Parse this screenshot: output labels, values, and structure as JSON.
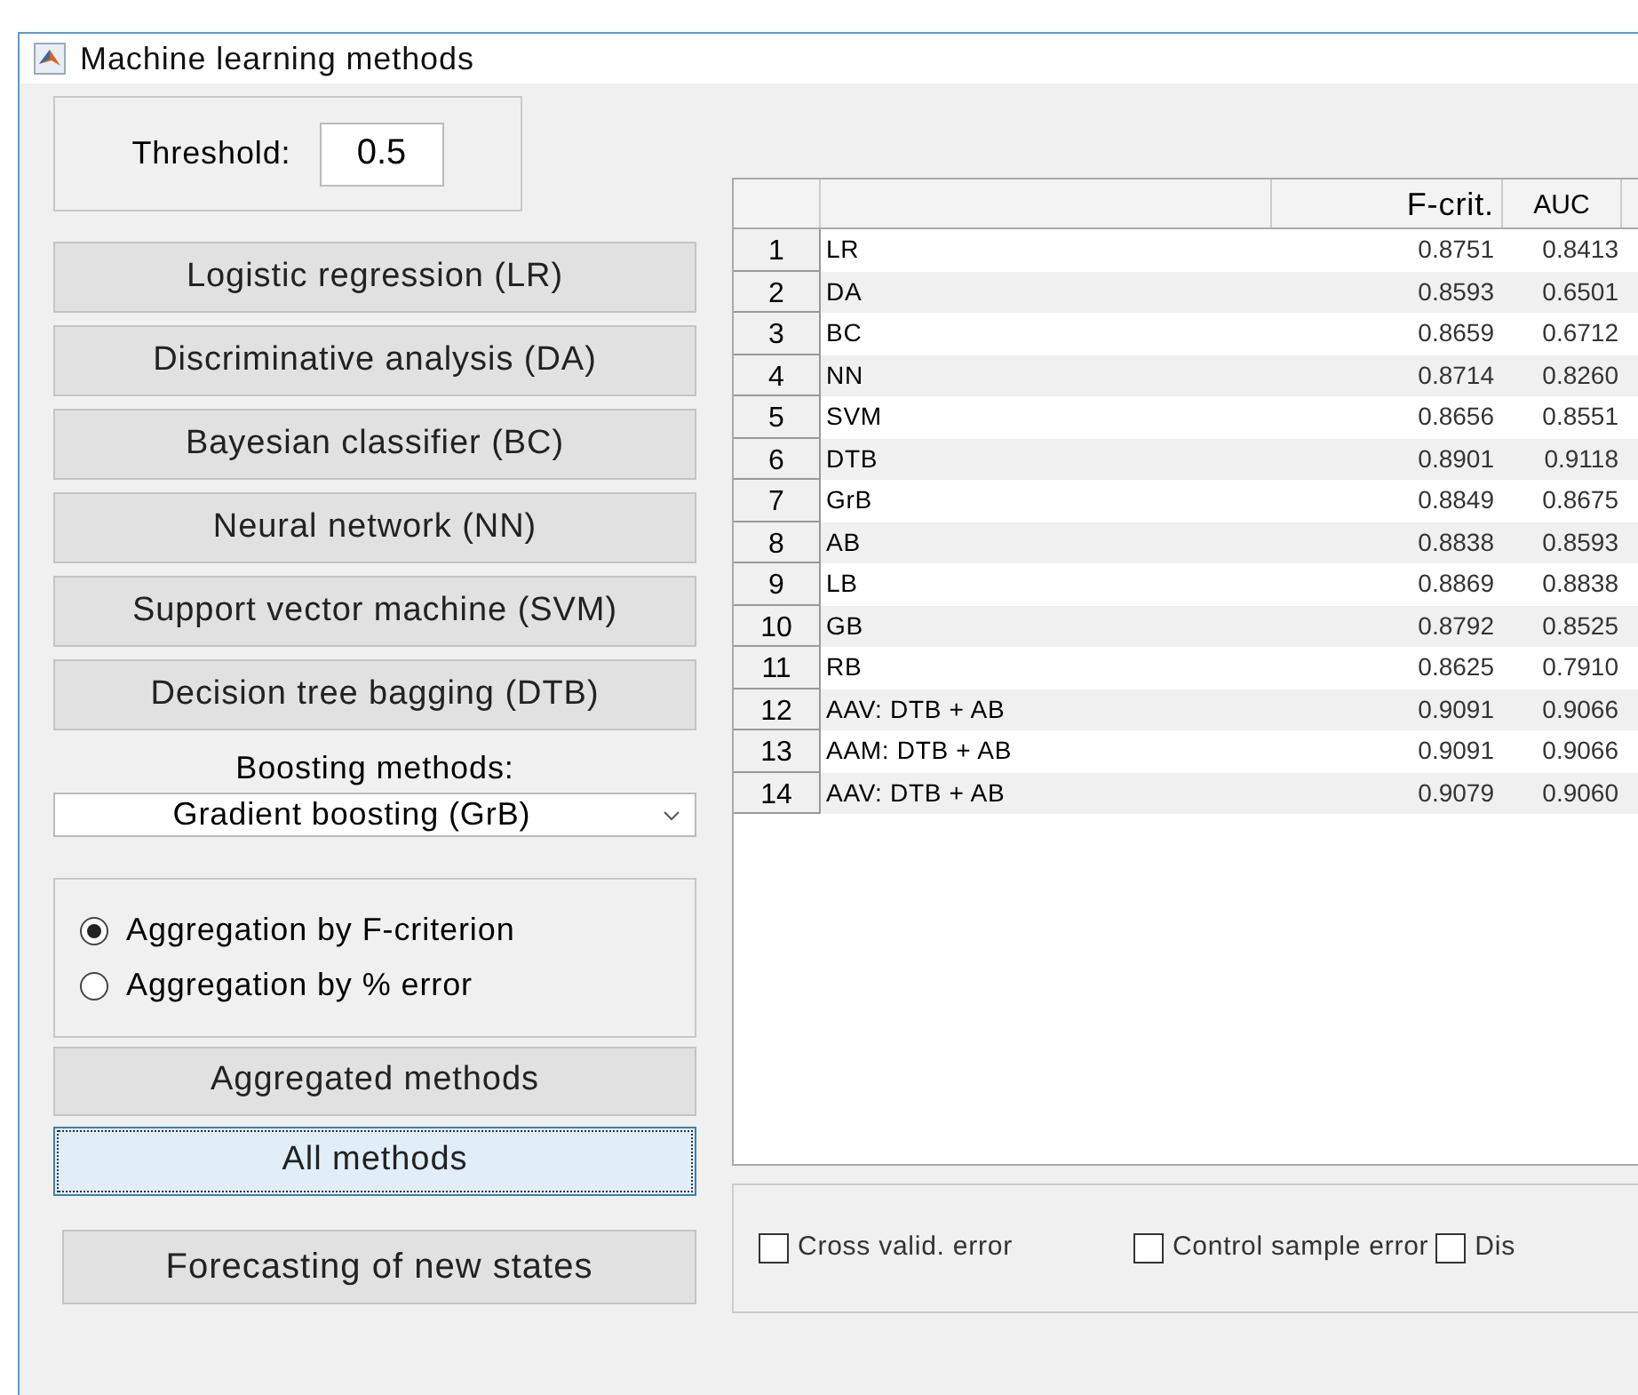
{
  "window": {
    "title": "Machine learning methods"
  },
  "threshold": {
    "label": "Threshold:",
    "value": "0.5"
  },
  "method_buttons": [
    "Logistic regression (LR)",
    "Discriminative analysis (DA)",
    "Bayesian classifier (BC)",
    "Neural network (NN)",
    "Support vector machine (SVM)",
    "Decision tree bagging (DTB)"
  ],
  "boosting": {
    "label": "Boosting methods:",
    "value": "Gradient boosting (GrB)"
  },
  "aggregation": [
    {
      "label": "Aggregation by F-criterion",
      "selected": true
    },
    {
      "label": "Aggregation by % error",
      "selected": false
    }
  ],
  "action_buttons": [
    {
      "label": "Aggregated methods",
      "focused": false
    },
    {
      "label": "All methods",
      "focused": true
    }
  ],
  "forecast_button": "Forecasting of new states",
  "table": {
    "columns": [
      "F-crit.",
      "AUC"
    ],
    "rows": [
      {
        "n": "1",
        "name": "LR",
        "f": "0.8751",
        "auc": "0.8413"
      },
      {
        "n": "2",
        "name": "DA",
        "f": "0.8593",
        "auc": "0.6501"
      },
      {
        "n": "3",
        "name": "BC",
        "f": "0.8659",
        "auc": "0.6712"
      },
      {
        "n": "4",
        "name": "NN",
        "f": "0.8714",
        "auc": "0.8260"
      },
      {
        "n": "5",
        "name": "SVM",
        "f": "0.8656",
        "auc": "0.8551"
      },
      {
        "n": "6",
        "name": "DTB",
        "f": "0.8901",
        "auc": "0.9118"
      },
      {
        "n": "7",
        "name": "GrB",
        "f": "0.8849",
        "auc": "0.8675"
      },
      {
        "n": "8",
        "name": "AB",
        "f": "0.8838",
        "auc": "0.8593"
      },
      {
        "n": "9",
        "name": "LB",
        "f": "0.8869",
        "auc": "0.8838"
      },
      {
        "n": "10",
        "name": "GB",
        "f": "0.8792",
        "auc": "0.8525"
      },
      {
        "n": "11",
        "name": "RB",
        "f": "0.8625",
        "auc": "0.7910"
      },
      {
        "n": "12",
        "name": "AAV: DTB + AB",
        "f": "0.9091",
        "auc": "0.9066"
      },
      {
        "n": "13",
        "name": "AAM: DTB + AB",
        "f": "0.9091",
        "auc": "0.9066"
      },
      {
        "n": "14",
        "name": "AAV: DTB + AB",
        "f": "0.9079",
        "auc": "0.9060"
      }
    ]
  },
  "error_options": [
    {
      "label": "Cross valid. error",
      "checked": false
    },
    {
      "label": "Control sample error",
      "checked": false
    },
    {
      "label": "Dis",
      "checked": false
    }
  ]
}
